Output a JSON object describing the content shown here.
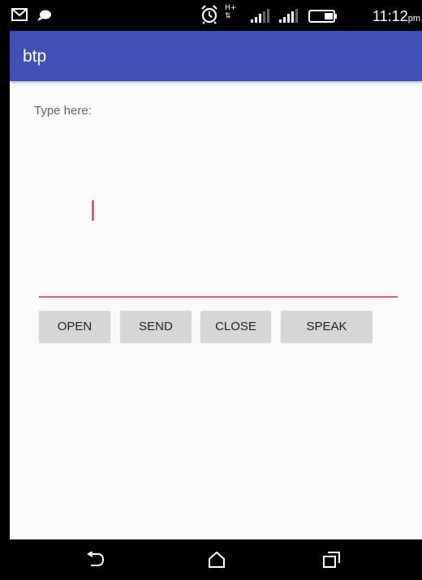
{
  "status_bar": {
    "time": "11:12",
    "ampm": "pm",
    "network_label": "H+",
    "icons": [
      "mail-icon",
      "chat-bubble-icon",
      "alarm-icon",
      "network-type-icon",
      "signal-icon",
      "signal-icon",
      "battery-icon"
    ]
  },
  "app_bar": {
    "title": "btp",
    "color": "#3f51b5"
  },
  "main": {
    "prompt_label": "Type here:",
    "input_value": "",
    "accent_color": "#e0578c",
    "buttons": [
      {
        "label": "OPEN"
      },
      {
        "label": "SEND"
      },
      {
        "label": "CLOSE"
      },
      {
        "label": "SPEAK"
      }
    ]
  },
  "nav_bar": {
    "icons": [
      "back-icon",
      "home-icon",
      "recents-icon"
    ]
  }
}
